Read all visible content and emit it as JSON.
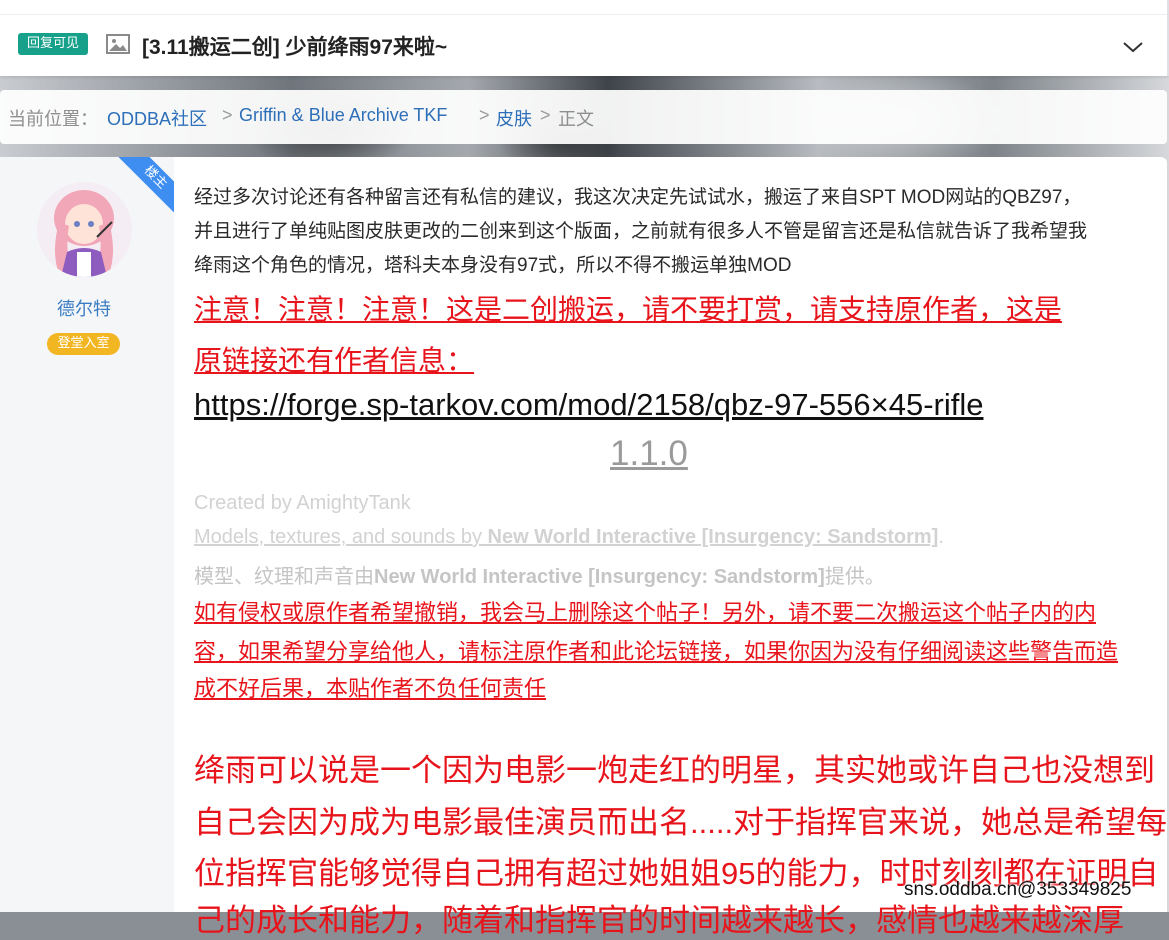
{
  "thread": {
    "badge": "回复可见",
    "title": "[3.11搬运二创] 少前绛雨97来啦~",
    "title_icon": "image-icon",
    "expand_icon": "chevron-down-icon"
  },
  "breadcrumb": {
    "prefix": "当前位置：",
    "items": [
      "ODDBA社区",
      "Griffin & Blue Archive TKF",
      "皮肤"
    ],
    "separator": ">",
    "current": "正文"
  },
  "author": {
    "corner_label": "楼主",
    "name": "德尔特",
    "rank": "登堂入室"
  },
  "post": {
    "intro_lines": [
      "经过多次讨论还有各种留言还有私信的建议，我这次决定先试试水，搬运了来自SPT MOD网站的QBZ97，",
      "并且进行了单纯贴图皮肤更改的二创来到这个版面，之前就有很多人不管是留言还是私信就告诉了我希望我",
      "绛雨这个角色的情况，塔科夫本身没有97式，所以不得不搬运单独MOD"
    ],
    "warning_lines": [
      "注意！注意！注意！这是二创搬运，请不要打赏，请支持原作者，这是",
      "原链接还有作者信息："
    ],
    "link": "https://forge.sp-tarkov.com/mod/2158/qbz-97-556×45-rifle",
    "version": "1.1.0",
    "created_by": "Created by AmightyTank",
    "models_prefix": "Models, textures, and sounds by ",
    "models_studio": "New World Interactive [Insurgency: Sandstorm]",
    "models_suffix": ".",
    "cn_prefix": "模型、纹理和声音由",
    "cn_studio": "New World Interactive [Insurgency: Sandstorm]",
    "cn_suffix": "提供。",
    "disclaimer_lines": [
      "如有侵权或原作者希望撤销，我会马上删除这个帖子！另外，请不要二次搬运这个帖子内的内",
      "容，如果希望分享给他人，请标注原作者和此论坛链接，如果你因为没有仔细阅读这些警告而造",
      "成不好后果，本贴作者不负任何责任"
    ],
    "story_lines": [
      "绛雨可以说是一个因为电影一炮走红的明星，其实她或许自己也没想到",
      "自己会因为成为电影最佳演员而出名.....对于指挥官来说，她总是希望每",
      "位指挥官能够觉得自己拥有超过她姐姐95的能力，时时刻刻都在证明自",
      "己的成长和能力，随着和指挥官的时间越来越长，感情也越来越深厚"
    ]
  },
  "watermark": "sns.oddba.cn@353349825",
  "colors": {
    "badge_green": "#17a08a",
    "link_blue": "#2d6fb8",
    "warning_red": "#e8141b",
    "corner_blue": "#3e8ef2",
    "rank_gold": "#f3b623"
  }
}
